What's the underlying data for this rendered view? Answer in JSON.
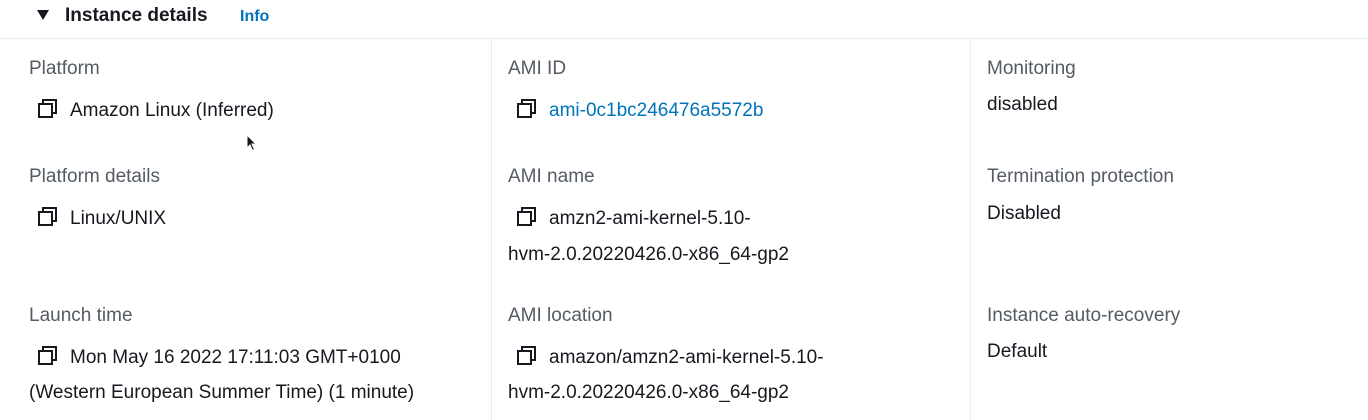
{
  "section": {
    "title": "Instance details",
    "info_label": "Info"
  },
  "col1": {
    "platform_label": "Platform",
    "platform_value": "Amazon Linux (Inferred)",
    "platform_details_label": "Platform details",
    "platform_details_value": "Linux/UNIX",
    "launch_time_label": "Launch time",
    "launch_time_line1": "Mon May 16 2022 17:11:03 GMT+0100",
    "launch_time_line2": "(Western European Summer Time) (1 minute)"
  },
  "col2": {
    "ami_id_label": "AMI ID",
    "ami_id_value": "ami-0c1bc246476a5572b",
    "ami_name_label": "AMI name",
    "ami_name_line1": "amzn2-ami-kernel-5.10-",
    "ami_name_line2": "hvm-2.0.20220426.0-x86_64-gp2",
    "ami_location_label": "AMI location",
    "ami_location_line1": "amazon/amzn2-ami-kernel-5.10-",
    "ami_location_line2": "hvm-2.0.20220426.0-x86_64-gp2"
  },
  "col3": {
    "monitoring_label": "Monitoring",
    "monitoring_value": "disabled",
    "termination_label": "Termination protection",
    "termination_value": "Disabled",
    "auto_recovery_label": "Instance auto-recovery",
    "auto_recovery_value": "Default"
  },
  "icons": {
    "copy": "copy-icon",
    "expand": "caret-down-icon",
    "cursor": "mouse-pointer-icon"
  },
  "colors": {
    "link": "#0073bb",
    "label": "#545b64",
    "text": "#16191f",
    "divider": "#eaeded"
  }
}
